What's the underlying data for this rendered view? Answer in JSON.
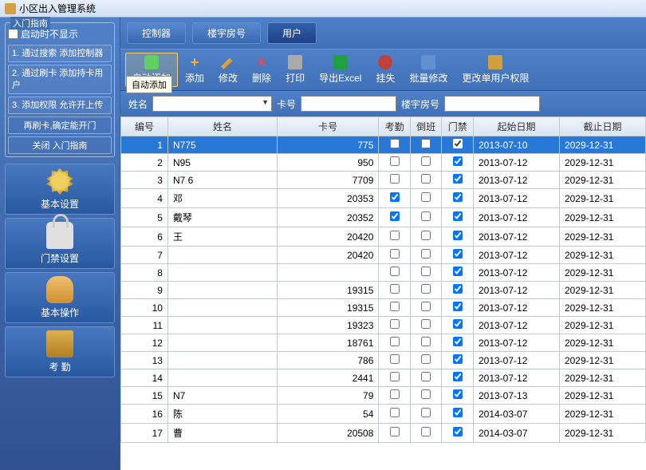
{
  "titlebar": {
    "title": "小区出入管理系统"
  },
  "guide": {
    "title": "入门指南",
    "hide_label": "启动时不显示",
    "items": [
      "1. 通过搜索\n   添加控制器",
      "2. 通过刷卡\n   添加持卡用户",
      "3. 添加权限\n   允许开上传"
    ],
    "footer": "再刷卡,确定能开门",
    "close": "关闭 入门指南"
  },
  "nav": [
    {
      "key": "basic-settings",
      "label": "基本设置",
      "icon": "gear"
    },
    {
      "key": "access-settings",
      "label": "门禁设置",
      "icon": "lock"
    },
    {
      "key": "basic-ops",
      "label": "基本操作",
      "icon": "hand"
    },
    {
      "key": "attendance",
      "label": "考 勤",
      "icon": "badge"
    }
  ],
  "tabs": [
    {
      "label": "控制器",
      "active": false
    },
    {
      "label": "楼宇房号",
      "active": false
    },
    {
      "label": "用户",
      "active": true
    }
  ],
  "toolbar": [
    {
      "key": "auto-add",
      "label": "自动添加",
      "icon": "auto",
      "active": true,
      "tooltip": "自动添加"
    },
    {
      "key": "add",
      "label": "添加",
      "icon": "add"
    },
    {
      "key": "edit",
      "label": "修改",
      "icon": "edit"
    },
    {
      "key": "delete",
      "label": "删除",
      "icon": "del"
    },
    {
      "key": "print",
      "label": "打印",
      "icon": "print"
    },
    {
      "key": "export-excel",
      "label": "导出Excel",
      "icon": "excel"
    },
    {
      "key": "report-lost",
      "label": "挂失",
      "icon": "lost"
    },
    {
      "key": "batch-edit",
      "label": "批量修改",
      "icon": "batch"
    },
    {
      "key": "change-perm",
      "label": "更改单用户权限",
      "icon": "perm"
    }
  ],
  "filters": {
    "name_label": "姓名",
    "name_value": "",
    "card_label": "卡号",
    "card_value": "",
    "room_label": "楼宇房号",
    "room_value": ""
  },
  "columns": [
    "编号",
    "姓名",
    "卡号",
    "考勤",
    "倒班",
    "门禁",
    "起始日期",
    "截止日期"
  ],
  "rows": [
    {
      "id": 1,
      "name": "N775",
      "card": "775",
      "att": false,
      "shift": false,
      "door": true,
      "start": "2013-07-10",
      "end": "2029-12-31",
      "sel": true
    },
    {
      "id": 2,
      "name": "N95",
      "card": "950",
      "att": false,
      "shift": false,
      "door": true,
      "start": "2013-07-12",
      "end": "2029-12-31"
    },
    {
      "id": 3,
      "name": "N7  6",
      "card": "7709",
      "att": false,
      "shift": false,
      "door": true,
      "start": "2013-07-12",
      "end": "2029-12-31"
    },
    {
      "id": 4,
      "name": "邓",
      "card": "20353",
      "att": true,
      "shift": false,
      "door": true,
      "start": "2013-07-12",
      "end": "2029-12-31"
    },
    {
      "id": 5,
      "name": "戴琴",
      "card": "20352",
      "att": true,
      "shift": false,
      "door": true,
      "start": "2013-07-12",
      "end": "2029-12-31"
    },
    {
      "id": 6,
      "name": "王",
      "card": "20420",
      "att": false,
      "shift": false,
      "door": true,
      "start": "2013-07-12",
      "end": "2029-12-31"
    },
    {
      "id": 7,
      "name": "",
      "card": "20420",
      "att": false,
      "shift": false,
      "door": true,
      "start": "2013-07-12",
      "end": "2029-12-31"
    },
    {
      "id": 8,
      "name": "",
      "card": "",
      "att": false,
      "shift": false,
      "door": true,
      "start": "2013-07-12",
      "end": "2029-12-31"
    },
    {
      "id": 9,
      "name": "",
      "card": "19315",
      "att": false,
      "shift": false,
      "door": true,
      "start": "2013-07-12",
      "end": "2029-12-31"
    },
    {
      "id": 10,
      "name": "",
      "card": "19315",
      "att": false,
      "shift": false,
      "door": true,
      "start": "2013-07-12",
      "end": "2029-12-31"
    },
    {
      "id": 11,
      "name": "",
      "card": "19323",
      "att": false,
      "shift": false,
      "door": true,
      "start": "2013-07-12",
      "end": "2029-12-31"
    },
    {
      "id": 12,
      "name": "",
      "card": "18761",
      "att": false,
      "shift": false,
      "door": true,
      "start": "2013-07-12",
      "end": "2029-12-31"
    },
    {
      "id": 13,
      "name": "",
      "card": "786",
      "att": false,
      "shift": false,
      "door": true,
      "start": "2013-07-12",
      "end": "2029-12-31"
    },
    {
      "id": 14,
      "name": "",
      "card": "2441",
      "att": false,
      "shift": false,
      "door": true,
      "start": "2013-07-12",
      "end": "2029-12-31"
    },
    {
      "id": 15,
      "name": "N7",
      "card": "79",
      "att": false,
      "shift": false,
      "door": true,
      "start": "2013-07-13",
      "end": "2029-12-31"
    },
    {
      "id": 16,
      "name": "陈",
      "card": "54",
      "att": false,
      "shift": false,
      "door": true,
      "start": "2014-03-07",
      "end": "2029-12-31"
    },
    {
      "id": 17,
      "name": "曹",
      "card": "20508",
      "att": false,
      "shift": false,
      "door": true,
      "start": "2014-03-07",
      "end": "2029-12-31"
    }
  ]
}
